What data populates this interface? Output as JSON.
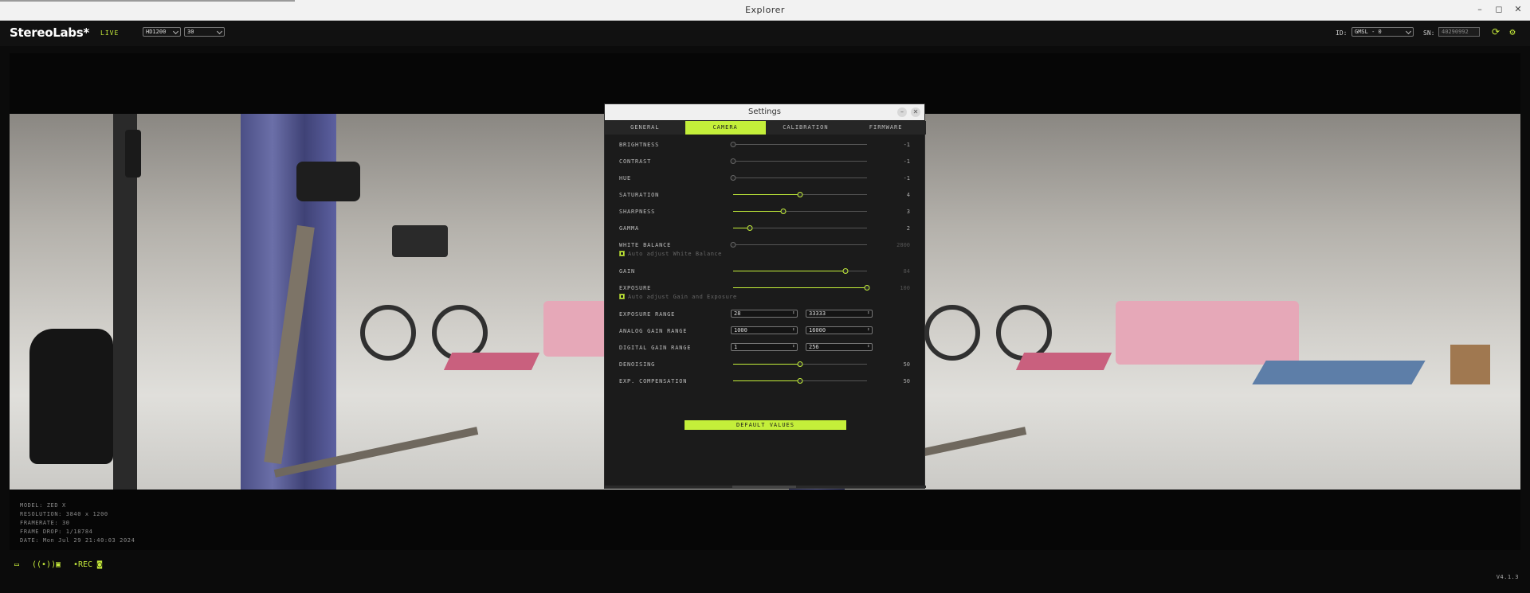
{
  "window": {
    "title": "Explorer",
    "minimize": "–",
    "maximize": "◻",
    "close": "✕"
  },
  "header": {
    "logo": "StereoLabs*",
    "live": "LIVE",
    "resolution_select": "HD1200",
    "fps_select": "30",
    "id_label": "ID:",
    "id_select": "GMSL - 0",
    "sn_label": "SN:",
    "sn_value": "40290992"
  },
  "info": {
    "model": "MODEL: ZED X",
    "resolution": "RESOLUTION: 3840 x 1200",
    "framerate": "FRAMERATE: 30",
    "frame_drop": "FRAME DROP: 1/18784",
    "date": "DATE: Mon Jul 29 21:40:03 2024"
  },
  "version": "V4.1.3",
  "settings": {
    "title": "Settings",
    "tabs": [
      "GENERAL",
      "CAMERA",
      "CALIBRATION",
      "FIRMWARE"
    ],
    "active_tab": "CAMERA",
    "sliders": {
      "brightness": {
        "label": "BRIGHTNESS",
        "value": "-1",
        "fraction": 0.0
      },
      "contrast": {
        "label": "CONTRAST",
        "value": "-1",
        "fraction": 0.0
      },
      "hue": {
        "label": "HUE",
        "value": "-1",
        "fraction": 0.0
      },
      "saturation": {
        "label": "SATURATION",
        "value": "4",
        "fraction": 0.5
      },
      "sharpness": {
        "label": "SHARPNESS",
        "value": "3",
        "fraction": 0.375
      },
      "gamma": {
        "label": "GAMMA",
        "value": "2",
        "fraction": 0.125
      },
      "white_balance": {
        "label": "WHITE BALANCE",
        "value": "2800",
        "fraction": 0.0
      },
      "gain": {
        "label": "GAIN",
        "value": "84",
        "fraction": 0.84
      },
      "exposure": {
        "label": "EXPOSURE",
        "value": "100",
        "fraction": 1.0
      },
      "denoising": {
        "label": "DENOISING",
        "value": "50",
        "fraction": 0.5
      },
      "exp_compensation": {
        "label": "EXP. COMPENSATION",
        "value": "50",
        "fraction": 0.5
      }
    },
    "auto_white_balance": "Auto adjust White Balance",
    "auto_gain_exposure": "Auto adjust Gain and Exposure",
    "ranges": {
      "exposure": {
        "label": "EXPOSURE RANGE",
        "min": "28",
        "max": "33333"
      },
      "analog_gain": {
        "label": "ANALOG GAIN RANGE",
        "min": "1000",
        "max": "16000"
      },
      "digital_gain": {
        "label": "DIGITAL GAIN RANGE",
        "min": "1",
        "max": "256"
      }
    },
    "default_button": "DEFAULT VALUES"
  },
  "colors": {
    "accent": "#c4ef3a",
    "background": "#0b0b0b",
    "panel": "#1b1b1b"
  },
  "icons": {
    "folder": "folder-icon",
    "stream": "stream-icon",
    "svo": "svo-icon",
    "rec": "record-icon",
    "camera": "camera-icon",
    "refresh": "refresh-icon",
    "settings": "gear-icon"
  }
}
